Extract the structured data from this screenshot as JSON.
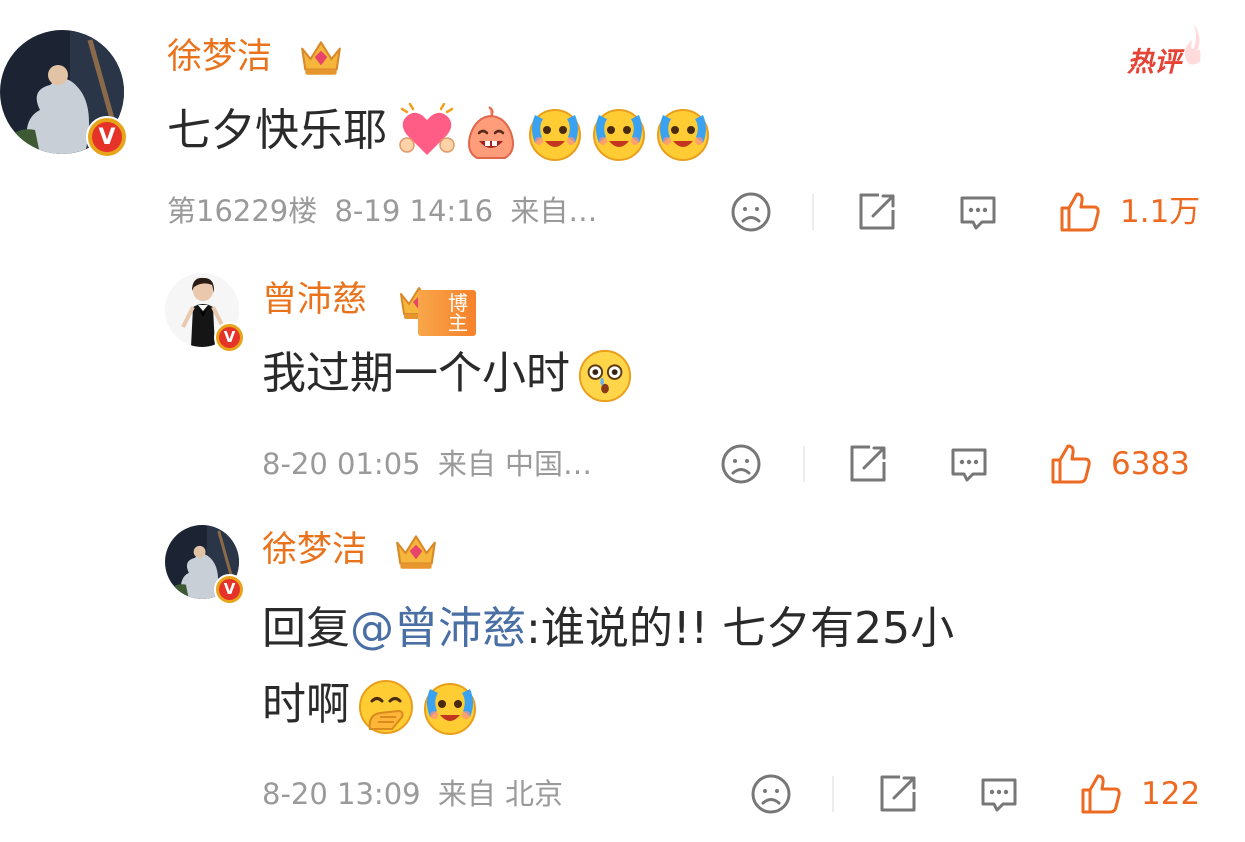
{
  "colors": {
    "accent": "#e9731c",
    "like": "#ec6a21",
    "mention": "#4a6fa5",
    "meta": "#9a9a9a",
    "hot": "#e54336"
  },
  "hot_label": "热评",
  "comments": [
    {
      "author": "徐梦洁",
      "text": "七夕快乐耶",
      "emojis": [
        "heart-hands-emoji",
        "smiling-blob-emoji",
        "crying-laugh-emoji",
        "crying-laugh-emoji",
        "crying-laugh-emoji"
      ],
      "floor": "第16229楼",
      "time": "8-19 14:16",
      "source": "来自…",
      "likes": "1.1万"
    },
    {
      "author": "曾沛慈",
      "badge": "博主",
      "text": "我过期一个小时",
      "emojis": [
        "shocked-emoji"
      ],
      "time": "8-20 01:05",
      "source": "来自 中国…",
      "likes": "6383"
    },
    {
      "author": "徐梦洁",
      "reply_prefix": "回复",
      "mention": "@曾沛慈",
      "text_line1": ":谁说的!! 七夕有25小",
      "text_line2": "时啊",
      "emojis": [
        "hand-over-mouth-emoji",
        "crying-laugh-emoji"
      ],
      "time": "8-20 13:09",
      "source": "来自 北京",
      "likes": "122"
    }
  ]
}
